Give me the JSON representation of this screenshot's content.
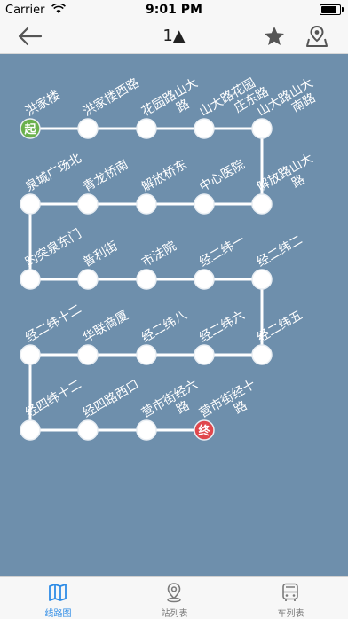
{
  "status_bar": {
    "carrier": "Carrier",
    "time": "9:01 PM"
  },
  "nav": {
    "title": "1▲",
    "icons": [
      "back-arrow-icon",
      "star-icon",
      "map-pin-icon"
    ]
  },
  "route": {
    "start_badge": "起",
    "end_badge": "终",
    "start_color": "#6ab04c",
    "end_color": "#e0474c",
    "line_color": "#ffffff",
    "background": "#6e8fac",
    "stops": [
      "洪家楼",
      "洪家楼西路",
      "花园路山大路",
      "山大路花园庄东路",
      "山大路山大南路",
      "解放路山大路",
      "中心医院",
      "解放桥东",
      "青龙桥南",
      "泉城广场北",
      "趵突泉东门",
      "普利街",
      "市法院",
      "经二纬一",
      "经二纬二",
      "经二纬五",
      "经二纬六",
      "经二纬八",
      "华联商厦",
      "经二纬十二",
      "经四纬十二",
      "经四路西口",
      "营市街经六路",
      "营市街经十路"
    ]
  },
  "tab_bar": {
    "items": [
      {
        "label": "线路图",
        "icon": "map-icon",
        "active": true
      },
      {
        "label": "站列表",
        "icon": "location-pin-icon",
        "active": false
      },
      {
        "label": "车列表",
        "icon": "bus-icon",
        "active": false
      }
    ],
    "active_color": "#2e8ce6",
    "inactive_color": "#7b7b7b"
  }
}
